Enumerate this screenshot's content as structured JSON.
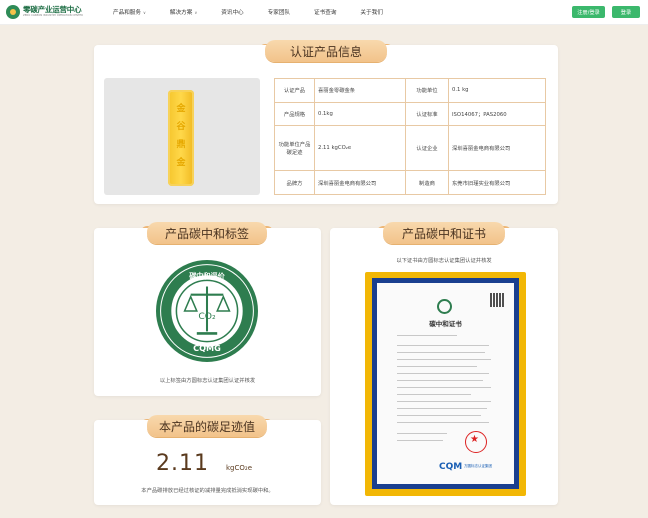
{
  "header": {
    "logo_title": "零碳产业运营中心",
    "logo_subtitle": "ZERO CARBON INDUSTRY OPERATION CENTER",
    "nav": [
      {
        "label": "产品和服务",
        "has_dropdown": true
      },
      {
        "label": "解决方案",
        "has_dropdown": true
      },
      {
        "label": "资讯中心",
        "has_dropdown": false
      },
      {
        "label": "专家团队",
        "has_dropdown": false
      },
      {
        "label": "证书查询",
        "has_dropdown": false
      },
      {
        "label": "关于我们",
        "has_dropdown": false
      }
    ],
    "register_label": "注册/登录",
    "login_label": "登录"
  },
  "info_card": {
    "title": "认证产品信息",
    "product_image_text": "金 谷 鼎 金",
    "rows": [
      {
        "k1": "认证产品",
        "v1": "喜丽金零碳金条",
        "k2": "功能单位",
        "v2": "0.1 kg"
      },
      {
        "k1": "产品规格",
        "v1": "0.1kg",
        "k2": "认证标准",
        "v2": "ISO14067；PAS2060"
      },
      {
        "k1": "功能单位产品碳足迹",
        "v1": "2.11 kgCO₂e",
        "k2": "认证企业",
        "v2": "深圳喜丽金电商有限公司"
      },
      {
        "k1": "品牌方",
        "v1": "深圳喜丽金电商有限公司",
        "k2": "制造商",
        "v2": "东莞市旧瑾实业有限公司"
      }
    ]
  },
  "label_card": {
    "title": "产品碳中和标签",
    "seal_top_text": "碳中和评价",
    "seal_center_text": "CO₂",
    "seal_bottom_text": "CQMG",
    "caption": "以上标签由方圆标志认证集团认证并核发"
  },
  "cert_card": {
    "title": "产品碳中和证书",
    "subtitle": "以下证书由方圆标志认证集团认证并核发",
    "cert_heading": "碳中和证书",
    "cert_brand": "CQM",
    "cert_brand_sub": "方圆标志认证集团"
  },
  "footprint_card": {
    "title": "本产品的碳足迹值",
    "value": "2.11",
    "unit": "kgCO₂e",
    "note": "本产品碳排放已经过核证的减排量完成抵消实现碳中和。"
  },
  "colors": {
    "page_bg": "#f3ede4",
    "ribbon": "#f2c38a",
    "table_border": "#e8c9a4",
    "seal_green": "#2e7d4f",
    "accent_green": "#3bb86c",
    "cert_frame": "#f2b705",
    "cert_border": "#1a3f8f"
  }
}
